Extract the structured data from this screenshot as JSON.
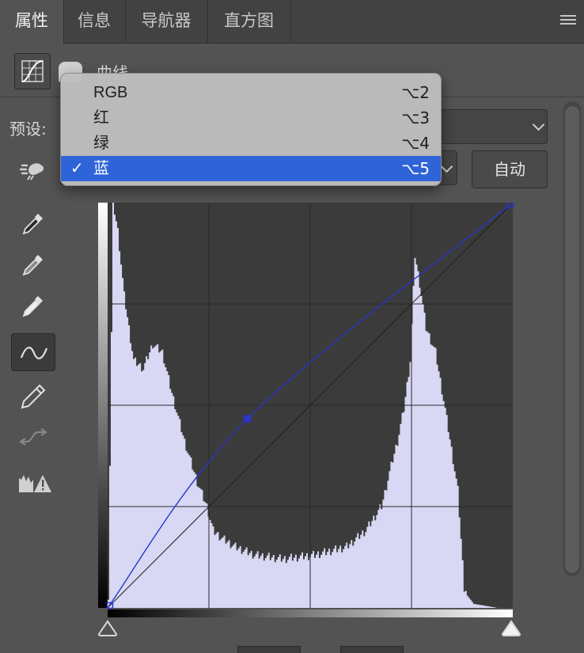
{
  "tabs": [
    {
      "label": "属性",
      "active": true
    },
    {
      "label": "信息",
      "active": false
    },
    {
      "label": "导航器",
      "active": false
    },
    {
      "label": "直方图",
      "active": false
    }
  ],
  "panel_menu_icon": "hamburger-icon",
  "header": {
    "title": "曲线",
    "adjustment_icon": "curves-adjustment-icon",
    "mask_icon": "layer-mask-icon"
  },
  "preset": {
    "label": "预设:"
  },
  "auto_button": {
    "label": "自动"
  },
  "channel_menu": {
    "items": [
      {
        "label": "RGB",
        "shortcut": "⌥2",
        "selected": false
      },
      {
        "label": "红",
        "shortcut": "⌥3",
        "selected": false
      },
      {
        "label": "绿",
        "shortcut": "⌥4",
        "selected": false
      },
      {
        "label": "蓝",
        "shortcut": "⌥5",
        "selected": true
      }
    ],
    "check_mark": "✓",
    "selected_color": "#2f63d8"
  },
  "tools": [
    {
      "name": "on-image-adjust-icon",
      "active": false
    },
    {
      "name": "black-point-eyedropper-icon",
      "active": false
    },
    {
      "name": "gray-point-eyedropper-icon",
      "active": false
    },
    {
      "name": "white-point-eyedropper-icon",
      "active": false
    },
    {
      "name": "curve-points-tool-icon",
      "active": true
    },
    {
      "name": "pencil-draw-icon",
      "active": false
    },
    {
      "name": "smooth-curve-icon",
      "active": false
    },
    {
      "name": "clipping-warning-icon",
      "active": false
    }
  ],
  "curve": {
    "channel": "蓝",
    "points": [
      [
        0,
        0
      ],
      [
        88,
        119
      ],
      [
        255,
        255
      ]
    ],
    "curve_color": "#2b35c8",
    "histogram_color": "#d8d8f4",
    "histogram_background": "#3b3b3b",
    "input_range": [
      0,
      255
    ],
    "output_range": [
      0,
      255
    ]
  }
}
